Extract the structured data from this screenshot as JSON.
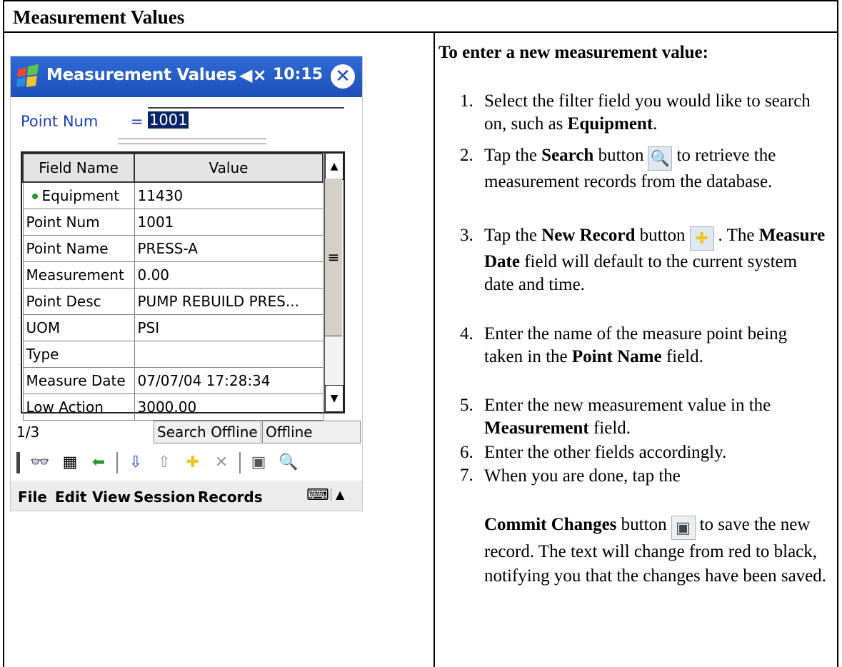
{
  "doc": {
    "title": "Measurement Values"
  },
  "device": {
    "title": "Measurement Values",
    "speaker_icon": "speaker-muted-icon",
    "time": "10:15",
    "filter": {
      "label": "Point Num",
      "operator": "=",
      "value": "1001"
    },
    "grid": {
      "headers": [
        "Field Name",
        "Value"
      ],
      "rows": [
        {
          "field": "Equipment",
          "value": "11430"
        },
        {
          "field": "Point Num",
          "value": "1001"
        },
        {
          "field": "Point Name",
          "value": "PRESS-A"
        },
        {
          "field": "Measurement",
          "value": "0.00"
        },
        {
          "field": "Point Desc",
          "value": "PUMP REBUILD PRES..."
        },
        {
          "field": "UOM",
          "value": "PSI"
        },
        {
          "field": "Type",
          "value": ""
        },
        {
          "field": "Measure Date",
          "value": "07/07/04 17:28:34"
        },
        {
          "field": "Low Action",
          "value": "3000.00"
        }
      ]
    },
    "status": {
      "page": "1/3",
      "search_mode": "Search Offline",
      "mode": "Offline"
    },
    "menu": [
      "File",
      "Edit",
      "View",
      "Session",
      "Records"
    ]
  },
  "instructions": {
    "heading": "To enter a new measurement value:",
    "steps": [
      {
        "n": "1.",
        "a": "Select the filter field you would like to search on, such as ",
        "b": "Equipment",
        "c": "."
      },
      {
        "n": "2.",
        "a": "Tap the ",
        "b": "Search",
        "c": " button",
        "d": "to retrieve the measurement records from the database."
      },
      {
        "n": "3.",
        "a": "Tap the ",
        "b": "New Record",
        "c": " button",
        "d": ". The ",
        "e": "Measure Date",
        "f": " field will default to the current system date and time."
      },
      {
        "n": "4.",
        "a": "Enter the name of the measure point being taken in the ",
        "b": "Point Name",
        "c": " field."
      },
      {
        "n": "5.",
        "a": "Enter the new measurement value in the ",
        "b": "Measurement",
        "c": " field."
      },
      {
        "n": "6.",
        "a": "Enter the other fields accordingly."
      },
      {
        "n": "7.",
        "a": "When you are done, tap the",
        "b": "Commit Changes",
        "c": " button",
        "d": "to save the new record. The text will change from red to black, notifying you that the changes have been saved."
      }
    ]
  }
}
